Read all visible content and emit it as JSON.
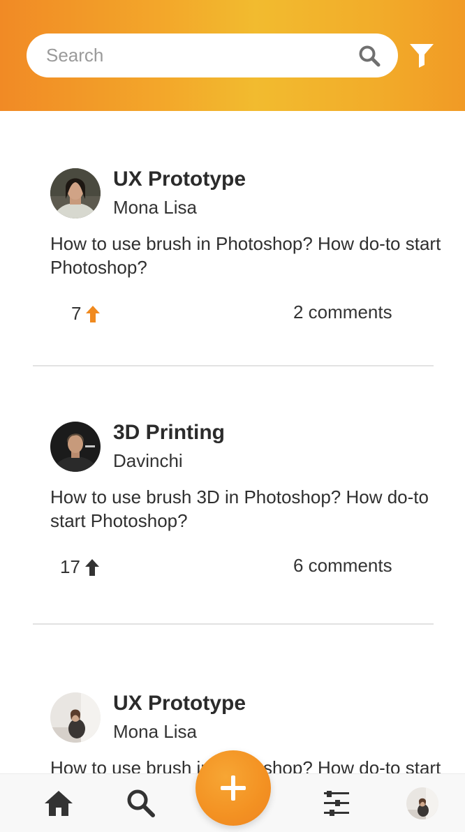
{
  "search": {
    "placeholder": "Search",
    "value": ""
  },
  "colors": {
    "accent": "#f39122",
    "header_gradient": [
      "#f18a25",
      "#f2bb2f"
    ],
    "upvote_active": "#f08a1f",
    "upvote_inactive": "#333333"
  },
  "posts": [
    {
      "title": "UX Prototype",
      "author": "Mona Lisa",
      "body": "How to use brush in Photoshop? How do-to start Photoshop?",
      "votes": "7",
      "upvoted": true,
      "comments": "2 comments"
    },
    {
      "title": "3D Printing",
      "author": "Davinchi",
      "body": "How to use brush 3D in Photoshop? How do-to start Photoshop?",
      "votes": "17",
      "upvoted": false,
      "comments": "6 comments"
    },
    {
      "title": "UX Prototype",
      "author": "Mona Lisa",
      "body": "How to use brush in Photoshop? How do-to start Photoshop?"
    }
  ],
  "nav": {
    "items": [
      "home-icon",
      "search-icon",
      "add-icon",
      "settings-sliders-icon",
      "profile-avatar"
    ]
  }
}
